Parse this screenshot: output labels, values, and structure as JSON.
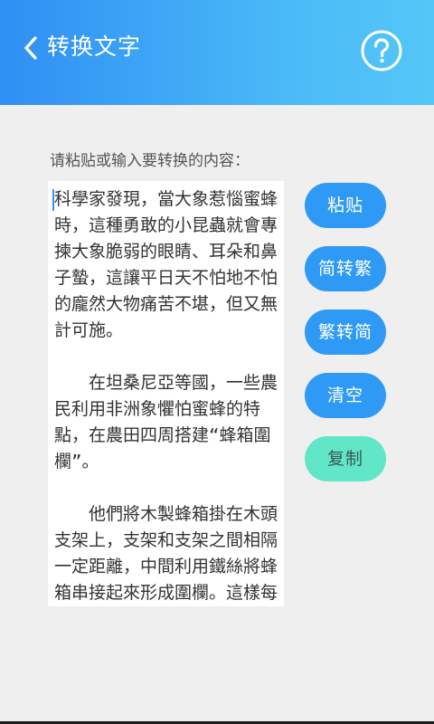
{
  "header": {
    "title": "转换文字",
    "back_icon": "chevron-left-icon",
    "help_icon": "question-circle-icon",
    "colors": {
      "gradient_start": "#2f8ff4",
      "gradient_end": "#54c7f8"
    }
  },
  "main": {
    "hint": "请粘贴或输入要转换的内容：",
    "content": "科學家發現，當大象惹惱蜜蜂時，這種勇敢的小昆蟲就會專揀大象脆弱的眼睛、耳朵和鼻子蟄，這讓平日天不怕地不怕的龐然大物痛苦不堪，但又無計可施。\n\n　　在坦桑尼亞等國，一些農民利用非洲象懼怕蜜蜂的特點，在農田四周搭建“蜂箱圍欄”。\n\n　　他們將木製蜂箱掛在木頭支架上，支架和支架之間相隔一定距離，中間利用鐵絲將蜂箱串接起來形成圍欄。這樣每當有大象想要硬"
  },
  "actions": {
    "paste": "粘贴",
    "to_traditional": "简转繁",
    "to_simplified": "繁转简",
    "clear": "清空",
    "copy": "复制",
    "colors": {
      "primary": "#2f9af5",
      "copy": "#61e6c8"
    }
  }
}
